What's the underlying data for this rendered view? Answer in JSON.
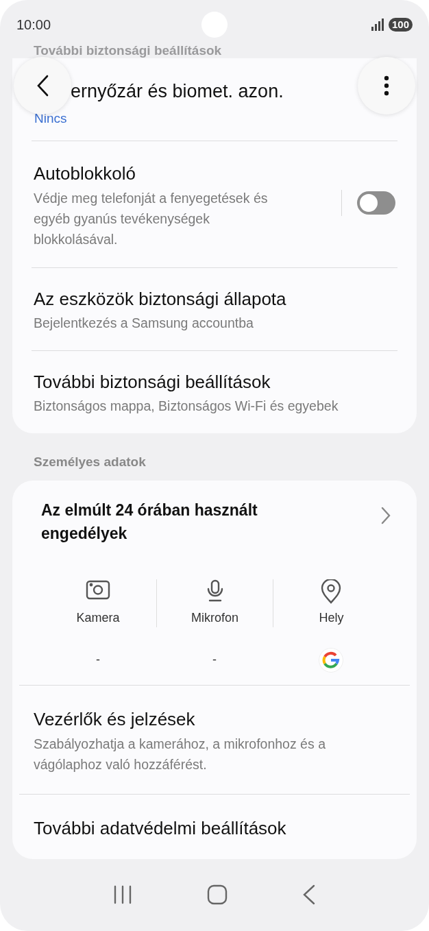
{
  "status_bar": {
    "time": "10:00",
    "battery": "100"
  },
  "scrolled_header": "További biztonsági beállítások",
  "app_bar": {
    "title": "ernyőzár és biomet. azon."
  },
  "security_card": {
    "value": "Nincs",
    "items": [
      {
        "kind": "toggle",
        "title": "Autoblokkoló",
        "subtitle": "Védje meg telefonját a fenyegetések és egyéb gyanús tevékenységek blokkolásával.",
        "on": false
      },
      {
        "kind": "link",
        "title": "Az eszközök biztonsági állapota",
        "subtitle": "Bejelentkezés a Samsung accountba"
      },
      {
        "kind": "link",
        "title": "További biztonsági beállítások",
        "subtitle": "Biztonságos mappa, Biztonságos Wi-Fi és egyebek"
      }
    ]
  },
  "privacy_section": {
    "label": "Személyes adatok",
    "permissions": {
      "title": "Az elmúlt 24 órában használt engedélyek",
      "columns": [
        {
          "kind": "camera",
          "label": "Kamera",
          "usage": "-"
        },
        {
          "kind": "microphone",
          "label": "Mikrofon",
          "usage": "-"
        },
        {
          "kind": "location",
          "label": "Hely",
          "used_by_app": true
        }
      ]
    },
    "items": [
      {
        "title": "Vezérlők és jelzések",
        "subtitle": "Szabályozhatja a kamerához, a mikrofonhoz és a vágólaphoz való hozzáférést."
      },
      {
        "title": "További adatvédelmi beállítások"
      }
    ]
  }
}
